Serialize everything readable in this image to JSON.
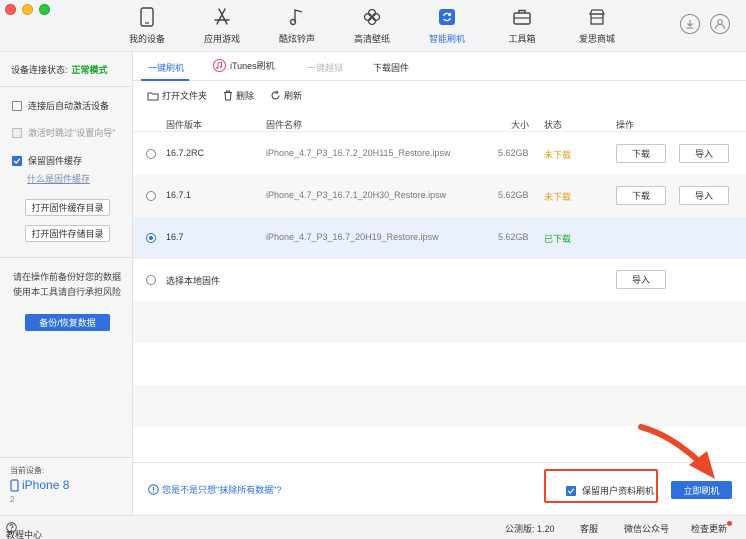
{
  "nav": [
    {
      "id": "my-device",
      "label": "我的设备",
      "icon": "phone-icon",
      "active": false
    },
    {
      "id": "apps",
      "label": "应用游戏",
      "icon": "appstore-icon",
      "active": false
    },
    {
      "id": "ringtones",
      "label": "酷炫铃声",
      "icon": "music-note-icon",
      "active": false
    },
    {
      "id": "wallpapers",
      "label": "高清壁纸",
      "icon": "flower-icon",
      "active": false
    },
    {
      "id": "flash",
      "label": "智能刷机",
      "icon": "refresh-icon",
      "active": true
    },
    {
      "id": "toolbox",
      "label": "工具箱",
      "icon": "toolbox-icon",
      "active": false
    },
    {
      "id": "store",
      "label": "爱思商城",
      "icon": "store-icon",
      "active": false
    }
  ],
  "sidebar": {
    "status_label": "设备连接状态:",
    "status_value": "正常模式",
    "opt_auto_activate": "连接后自动激活设备",
    "opt_skip_setup": "激活时跳过\"设置向导\"",
    "opt_keep_cache": "保留固件缓存",
    "link_what_cache": "什么是固件缓存",
    "btn_open_cache": "打开固件缓存目录",
    "btn_open_storage": "打开固件存储目录",
    "warn_text": "请在操作前备份好您的数据使用本工具请自行承担风险",
    "btn_backup": "备份/恢复数据",
    "device_label": "当前设备:",
    "device_name": "iPhone 8",
    "device_num": "2"
  },
  "tabs": [
    {
      "label": "一键刷机",
      "state": "active"
    },
    {
      "label": "iTunes刷机",
      "state": "normal"
    },
    {
      "label": "一键越狱",
      "state": "disabled"
    },
    {
      "label": "下载固件",
      "state": "normal"
    }
  ],
  "toolbar": {
    "open_folder": "打开文件夹",
    "delete": "删除",
    "refresh": "刷新"
  },
  "table": {
    "headers": {
      "version": "固件版本",
      "name": "固件名称",
      "size": "大小",
      "status": "状态",
      "action": "操作"
    },
    "rows": [
      {
        "version": "16.7.2RC",
        "name": "iPhone_4.7_P3_16.7.2_20H115_Restore.ipsw",
        "size": "5.62GB",
        "status": "未下载",
        "btn1": "下载",
        "btn2": "导入"
      },
      {
        "version": "16.7.1",
        "name": "iPhone_4.7_P3_16.7.1_20H30_Restore.ipsw",
        "size": "5.62GB",
        "status": "未下载",
        "btn1": "下载",
        "btn2": "导入"
      },
      {
        "version": "16.7",
        "name": "iPhone_4.7_P3_16.7_20H19_Restore.ipsw",
        "size": "5.62GB",
        "status": "已下载"
      },
      {
        "version": "选择本地固件",
        "btn1": "导入"
      }
    ]
  },
  "footer": {
    "hint": "您是不是只想\"抹除所有数据\"?",
    "keep_data": "保留用户资料刷机",
    "flash_now": "立即刷机"
  },
  "statusbar": {
    "tutorial": "教程中心",
    "version": "公测版: 1.20",
    "support": "客服",
    "wechat": "微信公众号",
    "update": "检查更新"
  },
  "colors": {
    "accent": "#2f6fde",
    "ok_green": "#1aa22e",
    "pending_orange": "#e39b1a",
    "highlight_red": "#e8492a"
  }
}
